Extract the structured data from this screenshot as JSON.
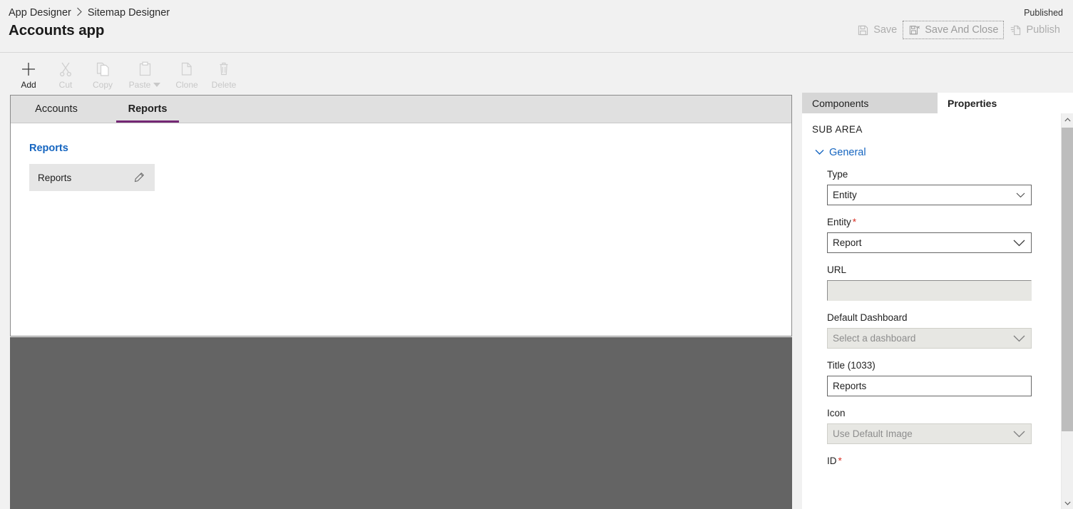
{
  "header": {
    "breadcrumb": {
      "parent": "App Designer",
      "separator_icon": "chevron-right-icon",
      "current": "Sitemap Designer"
    },
    "app_title": "Accounts app",
    "published_status": "Published",
    "actions": [
      {
        "label": "Save",
        "icon": "save-icon",
        "state": "disabled",
        "focused": false
      },
      {
        "label": "Save And Close",
        "icon": "save-and-close-icon",
        "state": "disabled",
        "focused": true
      },
      {
        "label": "Publish",
        "icon": "publish-icon",
        "state": "disabled",
        "focused": false
      }
    ]
  },
  "command_bar": {
    "buttons": [
      {
        "label": "Add",
        "icon": "plus-icon",
        "enabled": true,
        "has_caret": false
      },
      {
        "label": "Cut",
        "icon": "scissors-icon",
        "enabled": false,
        "has_caret": false
      },
      {
        "label": "Copy",
        "icon": "copy-icon",
        "enabled": false,
        "has_caret": false
      },
      {
        "label": "Paste",
        "icon": "clipboard-icon",
        "enabled": false,
        "has_caret": true
      },
      {
        "label": "Clone",
        "icon": "clone-icon",
        "enabled": false,
        "has_caret": false
      },
      {
        "label": "Delete",
        "icon": "trash-icon",
        "enabled": false,
        "has_caret": false
      }
    ]
  },
  "canvas": {
    "tabs": [
      {
        "label": "Accounts",
        "active": false
      },
      {
        "label": "Reports",
        "active": true
      }
    ],
    "accent_color": "#742774",
    "group": {
      "title": "Reports",
      "title_color": "#1565c0",
      "subareas": [
        {
          "label": "Reports",
          "edit_icon": "pencil-icon"
        }
      ]
    }
  },
  "properties_panel": {
    "tabs": [
      {
        "label": "Components",
        "active": false
      },
      {
        "label": "Properties",
        "active": true
      }
    ],
    "section_title": "SUB AREA",
    "accordion": {
      "label": "General",
      "icon": "chevron-down-icon",
      "expanded": true
    },
    "fields": [
      {
        "label": "Type",
        "required": false,
        "control": "select",
        "value": "Entity",
        "placeholder": "",
        "disabled": false,
        "icon": "chevron-down-icon"
      },
      {
        "label": "Entity",
        "required": true,
        "control": "select",
        "value": "Report",
        "placeholder": "",
        "disabled": false,
        "icon": "chevron-down-icon"
      },
      {
        "label": "URL",
        "required": false,
        "control": "text",
        "value": "",
        "placeholder": "",
        "disabled": true,
        "icon": ""
      },
      {
        "label": "Default Dashboard",
        "required": false,
        "control": "select",
        "value": "",
        "placeholder": "Select a dashboard",
        "disabled": true,
        "icon": "chevron-down-icon"
      },
      {
        "label": "Title (1033)",
        "required": false,
        "control": "text",
        "value": "Reports",
        "placeholder": "",
        "disabled": false,
        "icon": ""
      },
      {
        "label": "Icon",
        "required": false,
        "control": "select",
        "value": "",
        "placeholder": "Use Default Image",
        "disabled": true,
        "icon": "chevron-down-icon"
      },
      {
        "label": "ID",
        "required": true,
        "control": "text",
        "value": "",
        "placeholder": "",
        "disabled": false,
        "icon": ""
      }
    ],
    "scrollbar": {
      "up_icon": "chevron-up-icon",
      "down_icon": "chevron-down-icon"
    }
  }
}
